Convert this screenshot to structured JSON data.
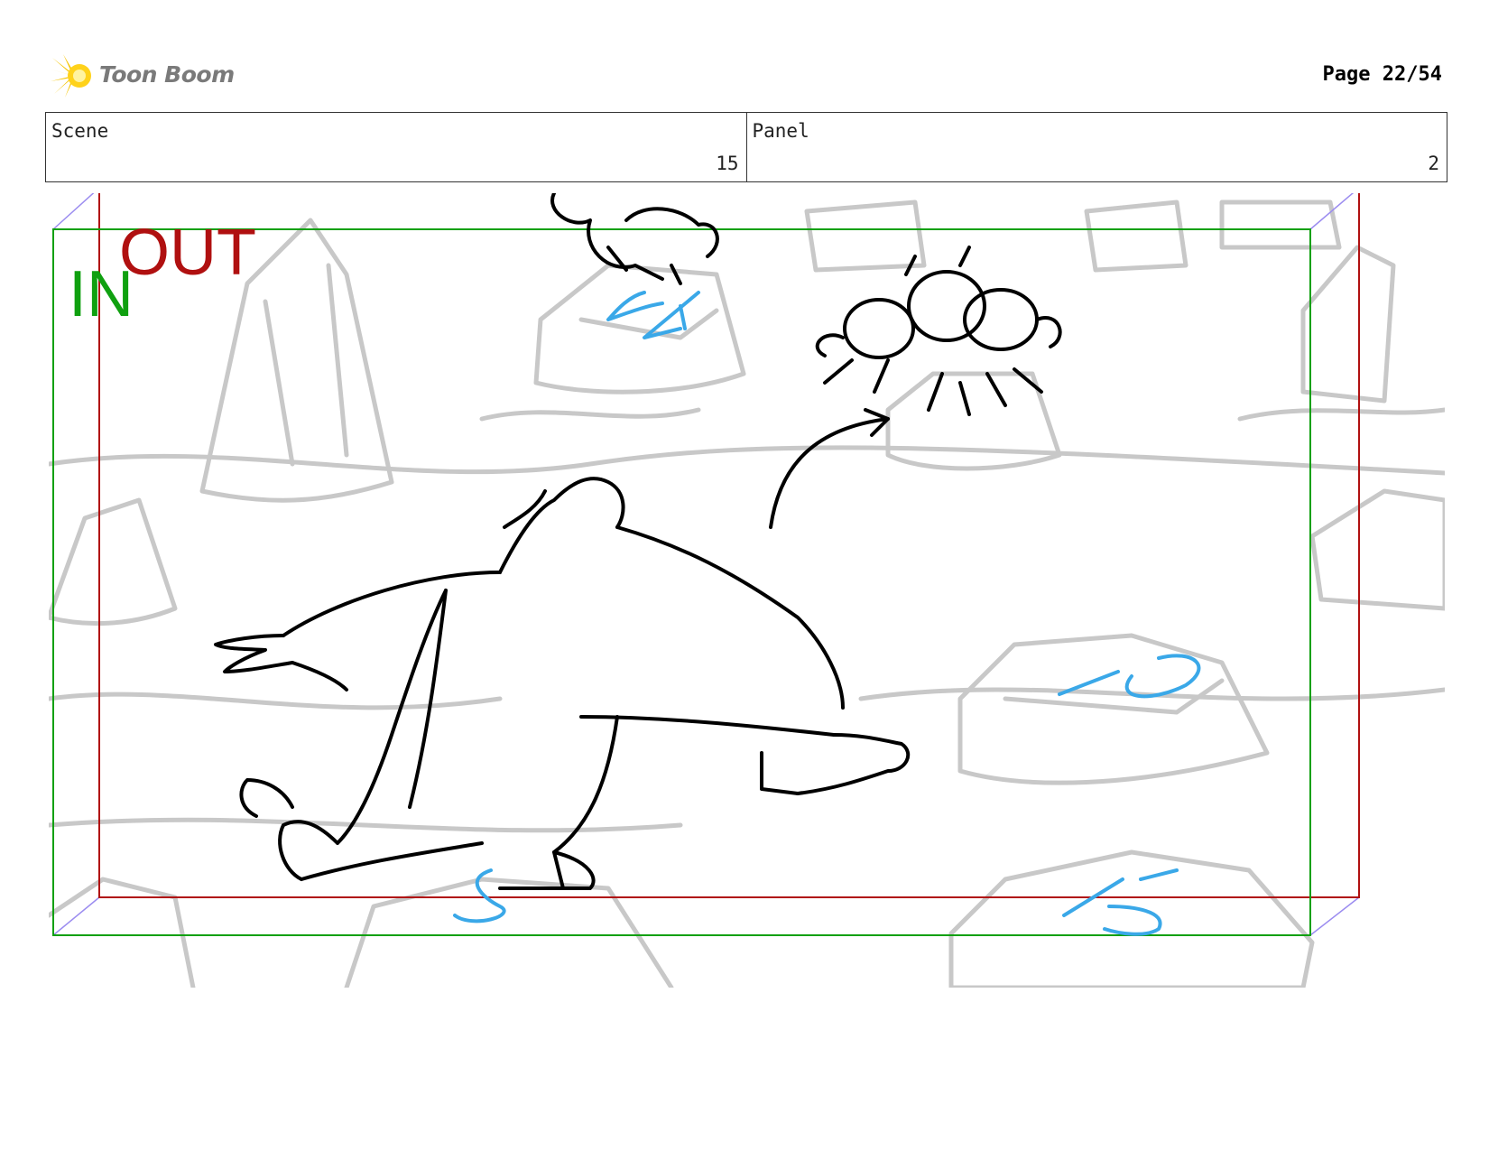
{
  "header": {
    "logo_text": "Toon Boom",
    "page_label": "Page 22/54"
  },
  "info": {
    "scene_label": "Scene",
    "scene_value": "15",
    "panel_label": "Panel",
    "panel_value": "2"
  },
  "panel": {
    "out_label": "OUT",
    "in_label": "IN",
    "timing_marks": [
      "64",
      "10",
      "15",
      "8"
    ],
    "colors": {
      "out_frame": "#b01010",
      "in_frame": "#10a010",
      "timing_marks": "#3aa8e8",
      "camera_path": "#9b8cf0"
    }
  }
}
